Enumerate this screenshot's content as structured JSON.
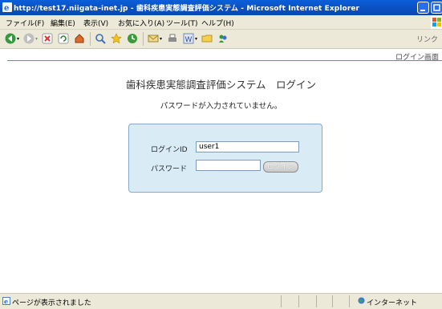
{
  "window": {
    "title": "http://test17.niigata-inet.jp - 歯科疾患実態調査評価システム - Microsoft Internet Explorer"
  },
  "menu": {
    "items": [
      "ファイル(F)",
      "編集(E)",
      "表示(V)",
      "お気に入り(A)",
      "ツール(T)",
      "ヘルプ(H)"
    ]
  },
  "toolbar": {
    "links_label": "リンク",
    "icons": [
      "back-icon",
      "forward-icon",
      "stop-icon",
      "refresh-icon",
      "home-icon",
      "search-icon",
      "favorites-icon",
      "history-icon",
      "mail-icon",
      "print-icon",
      "word-icon",
      "folder-icon",
      "messenger-icon"
    ]
  },
  "page": {
    "screen_name": "ログイン画面",
    "app_title": "歯科疾患実態調査評価システム　ログイン",
    "message": "パスワードが入力されていません。",
    "form": {
      "login_id_label": "ログインID",
      "login_id_value": "user1",
      "password_label": "パスワード",
      "password_value": "",
      "login_button": "ログイン"
    }
  },
  "status": {
    "text": "ページが表示されました",
    "zone": "インターネット"
  }
}
